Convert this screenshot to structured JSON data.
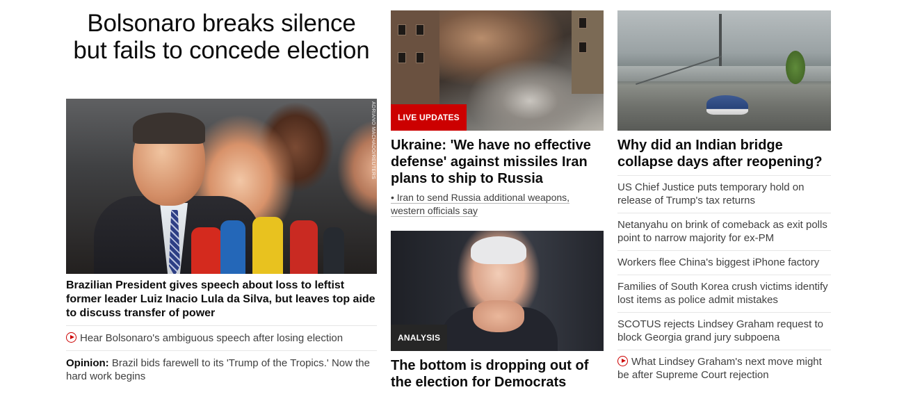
{
  "col1": {
    "headline": "Bolsonaro breaks silence but fails to concede election",
    "image_credit": "ADRIANO MACHADO/REUTERS",
    "summary": "Brazilian President gives speech about loss to leftist former leader Luiz Inacio Lula da Silva, but leaves top aide to discuss transfer of power",
    "related": [
      {
        "text": "Hear Bolsonaro's ambiguous speech after losing election",
        "icon": "play-icon"
      },
      {
        "label": "Opinion:",
        "text": "Brazil bids farewell to its 'Trump of the Tropics.' Now the hard work begins"
      }
    ]
  },
  "col2": {
    "card1": {
      "tag": "LIVE UPDATES",
      "headline": "Ukraine: 'We have no effective defense' against missiles Iran plans to ship to Russia",
      "bullet": "• Iran to send Russia additional weapons, western officials say"
    },
    "card2": {
      "tag": "ANALYSIS",
      "headline": "The bottom is dropping out of the election for Democrats"
    }
  },
  "col3": {
    "headline": "Why did an Indian bridge collapse days after reopening?",
    "items": [
      {
        "text": "US Chief Justice puts temporary hold on release of Trump's tax returns"
      },
      {
        "text": "Netanyahu on brink of comeback as exit polls point to narrow majority for ex-PM"
      },
      {
        "text": "Workers flee China's biggest iPhone factory"
      },
      {
        "text": "Families of South Korea crush victims identify lost items as police admit mistakes"
      },
      {
        "text": "SCOTUS rejects Lindsey Graham request to block Georgia grand jury subpoena"
      },
      {
        "text": "What Lindsey Graham's next move might be after Supreme Court rejection",
        "icon": "play-icon"
      }
    ]
  },
  "colors": {
    "live_tag": "#cc0000",
    "analysis_tag": "#262626",
    "play_icon": "#cc0000",
    "text_primary": "#0c0c0c",
    "text_secondary": "#404040"
  }
}
